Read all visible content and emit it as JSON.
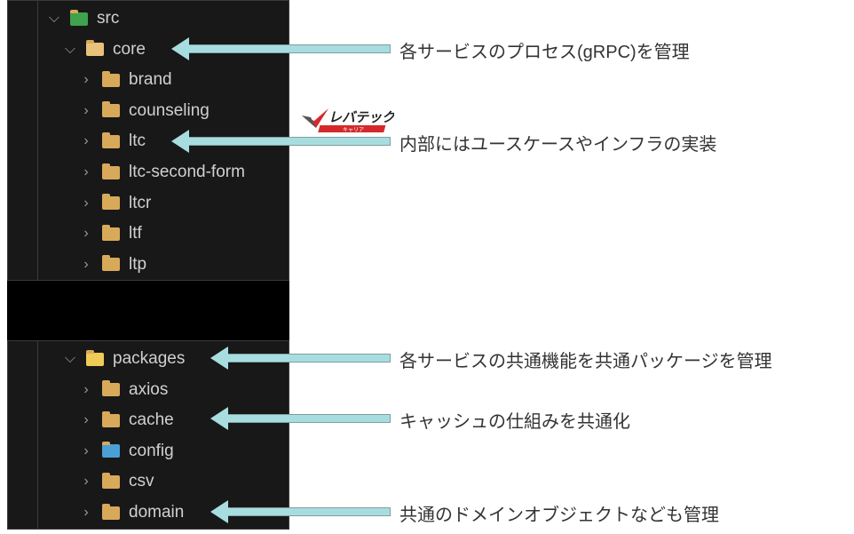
{
  "tree_top": [
    {
      "label": "src",
      "icon": "source-folder-icon",
      "expanded": true,
      "depth": 0
    },
    {
      "label": "core",
      "icon": "folder-open-icon",
      "expanded": true,
      "depth": 1
    },
    {
      "label": "brand",
      "icon": "folder-icon",
      "expanded": false,
      "depth": 2
    },
    {
      "label": "counseling",
      "icon": "folder-icon",
      "expanded": false,
      "depth": 2
    },
    {
      "label": "ltc",
      "icon": "folder-icon",
      "expanded": false,
      "depth": 2
    },
    {
      "label": "ltc-second-form",
      "icon": "folder-icon",
      "expanded": false,
      "depth": 2
    },
    {
      "label": "ltcr",
      "icon": "folder-icon",
      "expanded": false,
      "depth": 2
    },
    {
      "label": "ltf",
      "icon": "folder-icon",
      "expanded": false,
      "depth": 2
    },
    {
      "label": "ltp",
      "icon": "folder-icon",
      "expanded": false,
      "depth": 2
    }
  ],
  "tree_bottom": [
    {
      "label": "packages",
      "icon": "folder-open-icon",
      "expanded": true,
      "depth": 1
    },
    {
      "label": "axios",
      "icon": "folder-icon",
      "expanded": false,
      "depth": 2
    },
    {
      "label": "cache",
      "icon": "folder-icon",
      "expanded": false,
      "depth": 2
    },
    {
      "label": "config",
      "icon": "config-folder-icon",
      "expanded": false,
      "depth": 2
    },
    {
      "label": "csv",
      "icon": "folder-icon",
      "expanded": false,
      "depth": 2
    },
    {
      "label": "domain",
      "icon": "folder-icon",
      "expanded": false,
      "depth": 2
    }
  ],
  "annotations": [
    {
      "target": "core",
      "text": "各サービスのプロセス(gRPC)を管理"
    },
    {
      "target": "ltc",
      "text": "内部にはユースケースやインフラの実装"
    },
    {
      "target": "packages",
      "text": "各サービスの共通機能を共通パッケージを管理"
    },
    {
      "target": "cache",
      "text": "キャッシュの仕組みを共通化"
    },
    {
      "target": "domain",
      "text": "共通のドメインオブジェクトなども管理"
    }
  ],
  "logo": {
    "text": "レバテック",
    "sub": "キャリア"
  },
  "colors": {
    "arrow": "#a8dde0",
    "folder": "#d9a95a",
    "panel": "#181818"
  }
}
